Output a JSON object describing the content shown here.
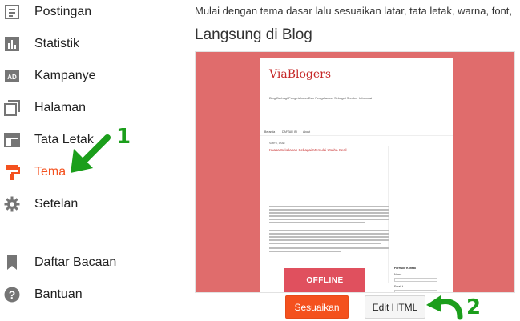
{
  "sidebar": {
    "items": [
      {
        "label": "Postingan",
        "icon": "posts-icon"
      },
      {
        "label": "Statistik",
        "icon": "stats-icon"
      },
      {
        "label": "Kampanye",
        "icon": "ad-icon"
      },
      {
        "label": "Halaman",
        "icon": "pages-icon"
      },
      {
        "label": "Tata Letak",
        "icon": "layout-icon"
      },
      {
        "label": "Tema",
        "icon": "paint-roller-icon",
        "active": true
      },
      {
        "label": "Setelan",
        "icon": "gear-icon"
      },
      {
        "label": "Daftar Bacaan",
        "icon": "bookmark-icon"
      },
      {
        "label": "Bantuan",
        "icon": "help-icon"
      }
    ]
  },
  "main": {
    "intro": "Mulai dengan tema dasar lalu sesuaikan latar, tata letak, warna, font,",
    "section_title": "Langsung di Blog",
    "preview": {
      "blog_title": "ViaBlogers",
      "blog_description": "Blog Berbagi Pengetahuan Dan Pengalaman Sebagai Sumber Informasi",
      "tabs": [
        "Beranda",
        "DAFTAR ISI",
        "About"
      ],
      "post_meta": "SABTU, 1 MEI",
      "post_title": "Kuasa Sekalahan Sebagai Memulai Usaha Kecil",
      "sidebar_heading": "Formulir Kontak",
      "sidebar_labels": [
        "Nama",
        "Email *"
      ],
      "offline_badge": "OFFLINE"
    },
    "buttons": {
      "customize": "Sesuaikan",
      "edit_html": "Edit HTML"
    }
  },
  "annotations": {
    "step1": "1",
    "step2": "2",
    "arrow_color": "#1b9e1b"
  },
  "colors": {
    "accent": "#f4511e",
    "preview_bg": "#e06c6c",
    "offline": "#e0505e"
  }
}
